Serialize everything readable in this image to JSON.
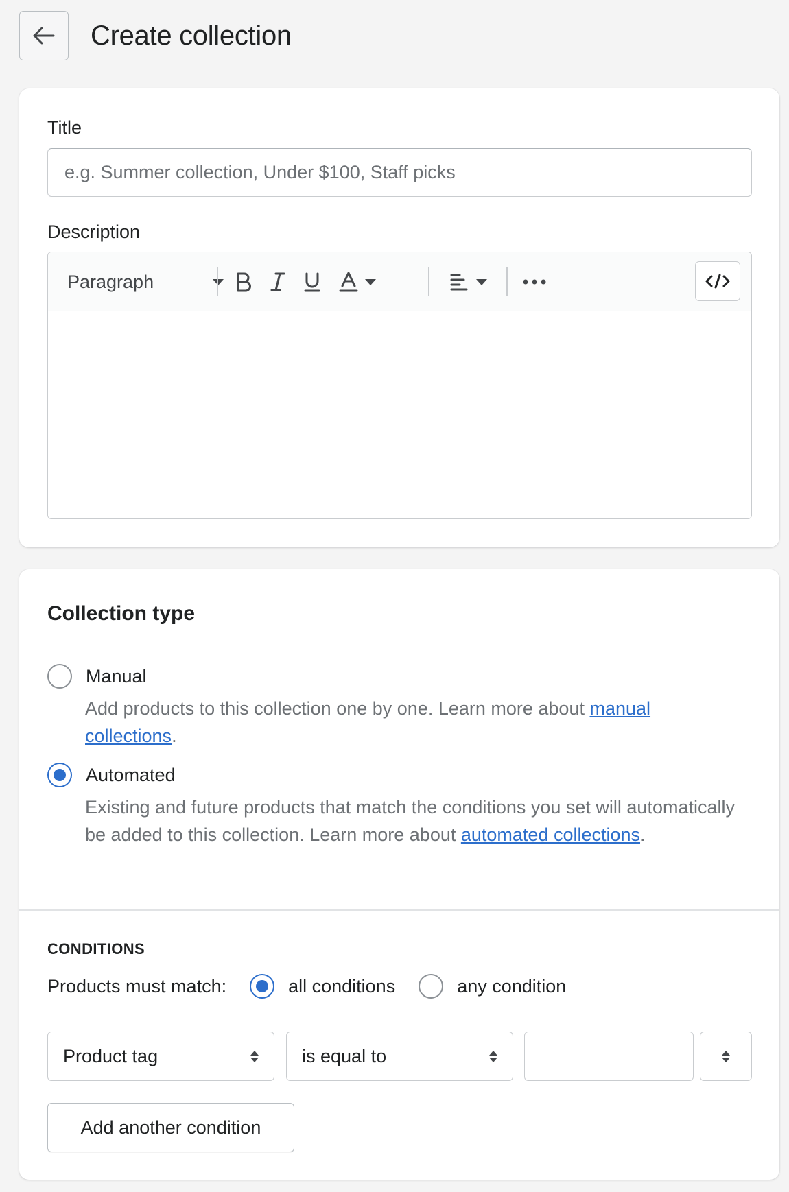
{
  "header": {
    "title": "Create collection",
    "back_icon": "arrow-left-icon"
  },
  "details": {
    "title_label": "Title",
    "title_placeholder": "e.g. Summer collection, Under $100, Staff picks",
    "title_value": "",
    "description_label": "Description",
    "toolbar": {
      "format_select": "Paragraph",
      "bold": "B",
      "italic": "I",
      "underline": "U",
      "text_color": "A"
    }
  },
  "collection_type": {
    "title": "Collection type",
    "manual_label": "Manual",
    "manual_help": "Add products to this collection one by one. Learn more about ",
    "manual_link": "manual collections",
    "automated_label": "Automated",
    "automated_help": "Existing and future products that match the conditions you set will automatically be added to this collection. Learn more about ",
    "automated_link": "automated collections",
    "period": ".",
    "selected": "Automated"
  },
  "conditions": {
    "title": "CONDITIONS",
    "match_label": "Products must match:",
    "all_label": "all conditions",
    "any_label": "any condition",
    "selected_match": "all conditions",
    "field_select": "Product tag",
    "operator_select": "is equal to",
    "value": "",
    "add_button": "Add another condition"
  },
  "colors": {
    "accent": "#2c6ecb",
    "background": "#f4f4f4",
    "text": "#202223",
    "muted": "#6d7175"
  }
}
